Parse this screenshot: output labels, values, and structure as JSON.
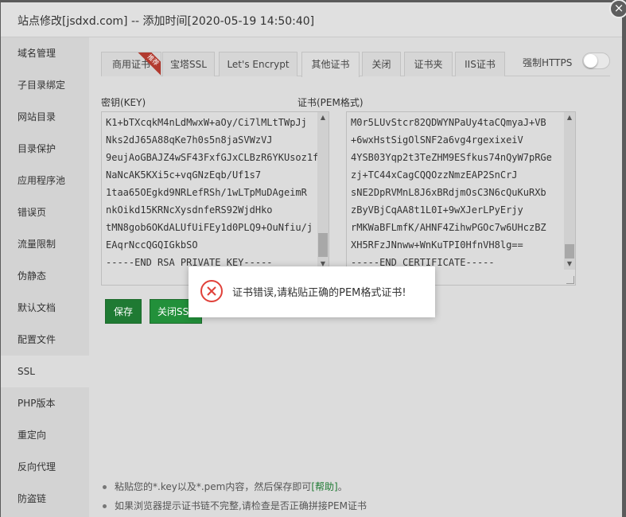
{
  "window": {
    "title": "站点修改[jsdxd.com] -- 添加时间[2020-05-19 14:50:40]",
    "close_glyph": "×"
  },
  "sidebar": {
    "items": [
      {
        "label": "域名管理"
      },
      {
        "label": "子目录绑定"
      },
      {
        "label": "网站目录"
      },
      {
        "label": "目录保护"
      },
      {
        "label": "应用程序池"
      },
      {
        "label": "错误页"
      },
      {
        "label": "流量限制"
      },
      {
        "label": "伪静态"
      },
      {
        "label": "默认文档"
      },
      {
        "label": "配置文件"
      },
      {
        "label": "SSL",
        "active": true
      },
      {
        "label": "PHP版本"
      },
      {
        "label": "重定向"
      },
      {
        "label": "反向代理"
      },
      {
        "label": "防盗链"
      }
    ]
  },
  "tabs": {
    "items": [
      {
        "label": "商用证书"
      },
      {
        "label": "宝塔SSL"
      },
      {
        "label": "Let's Encrypt"
      },
      {
        "label": "其他证书"
      },
      {
        "label": "关闭"
      },
      {
        "label": "证书夹"
      },
      {
        "label": "IIS证书"
      }
    ],
    "ribbon": "推荐",
    "force_https_label": "强制HTTPS",
    "force_https_enabled": false
  },
  "key": {
    "label": "密钥(KEY)",
    "lines": [
      "K1+bTXcqkM4nLdMwxW+aOy/Ci7lMLtTWpJj",
      "Nks2dJ65A88qKe7h0s5n8jaSVWzVJ",
      "9eujAoGBAJZ4wSF43FxfGJxCLBzR6YKUsoz1f",
      "NaNcAK5KXi5c+vqGNzEqb/Uf1s7",
      "1taa65OEgkd9NRLefRSh/1wLTpMuDAgeimR",
      "nkOikd15KRNcXysdnfeRS92WjdHko",
      "tMN8gob6OKdALUfUiFEy1d0PLQ9+OuNfiu/j",
      "EAqrNccQGQIGkbSO",
      "-----END RSA PRIVATE KEY-----"
    ]
  },
  "cert": {
    "label": "证书(PEM格式)",
    "lines": [
      "M0r5LUvStcr82QDWYNPaUy4taCQmyaJ+VB",
      "+6wxHstSigOlSNF2a6vg4rgexixeiV",
      "4YSB03Yqp2t3TeZHM9ESfkus74nQyW7pRGe",
      "zj+TC44xCagCQQOzzNmzEAP2SnCrJ",
      "sNE2DpRVMnL8J6xBRdjmOsC3N6cQuKuRXb",
      "zByVBjCqAA8t1L0I+9wXJerLPyErjy",
      "rMKWaBFLmfK/AHNF4ZihwPGOc7w6UHczBZ",
      "XH5RFzJNnww+WnKuTPI0HfnVH8lg==",
      "-----END CERTIFICATE-----"
    ]
  },
  "buttons": {
    "save": "保存",
    "close_ssl": "关闭SSL"
  },
  "notes": {
    "line1_prefix": "粘贴您的*.key以及*.pem内容，然后保存即可",
    "help": "[帮助]",
    "line1_suffix": "。",
    "line2": "如果浏览器提示证书链不完整,请检查是否正确拼接PEM证书"
  },
  "dialog": {
    "message": "证书错误,请粘贴正确的PEM格式证书!",
    "icon": "error-circle-icon"
  },
  "colors": {
    "accent_green": "#1f7a33",
    "ribbon_red": "#b23a2f",
    "error_red": "#e0413a"
  }
}
